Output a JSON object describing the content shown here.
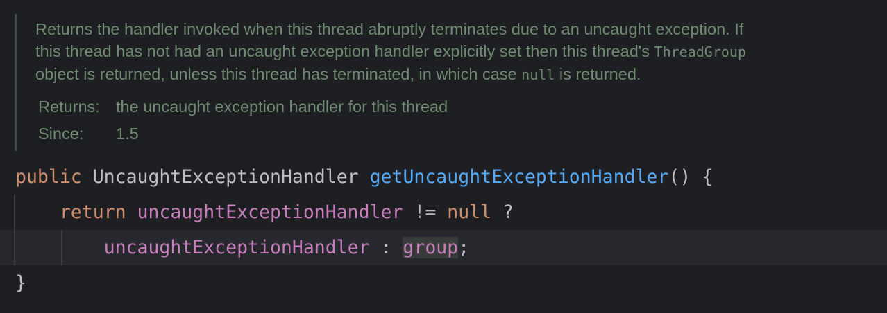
{
  "javadoc": {
    "description_lines": [
      [
        "Returns the handler invoked when this thread abruptly terminates due to an uncaught exception. If"
      ],
      [
        "this thread has not had an uncaught exception handler explicitly set then this thread's ",
        "ThreadGroup"
      ],
      [
        "object is returned, unless this thread has terminated, in which case ",
        "null",
        " is returned."
      ]
    ],
    "line1": "Returns the handler invoked when this thread abruptly terminates due to an uncaught exception. If",
    "line2_text": "this thread has not had an uncaught exception handler explicitly set then this thread's ",
    "line2_code": "ThreadGroup",
    "line3_text_a": "object is returned, unless this thread has terminated, in which case ",
    "line3_code": "null",
    "line3_text_b": " is returned.",
    "returns_label": "Returns:",
    "returns_value": "the uncaught exception handler for this thread",
    "since_label": "Since:",
    "since_value": "1.5"
  },
  "code": {
    "line1": {
      "modifier": "public",
      "return_type": "UncaughtExceptionHandler",
      "method": "getUncaughtExceptionHandler",
      "rest": "() {"
    },
    "line2": {
      "keyword": "return",
      "field": "uncaughtExceptionHandler",
      "operator": " != ",
      "literal": "null",
      "rest": " ?"
    },
    "line3": {
      "field": "uncaughtExceptionHandler",
      "operator": " : ",
      "field2": "group",
      "rest": ";"
    },
    "line4": {
      "brace": "}"
    }
  },
  "colors": {
    "background": "#1e1f22",
    "doc_text": "#6f8972",
    "keyword": "#cf8e6d",
    "method": "#56a8f5",
    "field": "#c77dbb",
    "default_text": "#bcbec4"
  }
}
